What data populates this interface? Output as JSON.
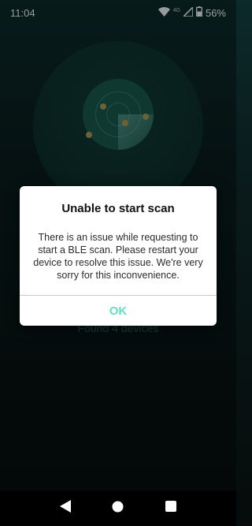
{
  "status_bar": {
    "time": "11:04",
    "network": "4G",
    "battery": "56%",
    "icons": [
      "wifi-icon",
      "signal-icon",
      "battery-icon"
    ]
  },
  "background": {
    "found_text": "Found 4 devices"
  },
  "dialog": {
    "title": "Unable to start scan",
    "message": "There is an issue while requesting to start a BLE scan. Please restart your device to resolve this issue. We're very sorry for this inconvenience.",
    "ok_label": "OK"
  },
  "nav_bar": {
    "buttons": [
      "back-icon",
      "home-icon",
      "recents-icon"
    ]
  },
  "colors": {
    "accent": "#5fe0c8",
    "dot": "#a8974f",
    "radar": "#17574c"
  }
}
